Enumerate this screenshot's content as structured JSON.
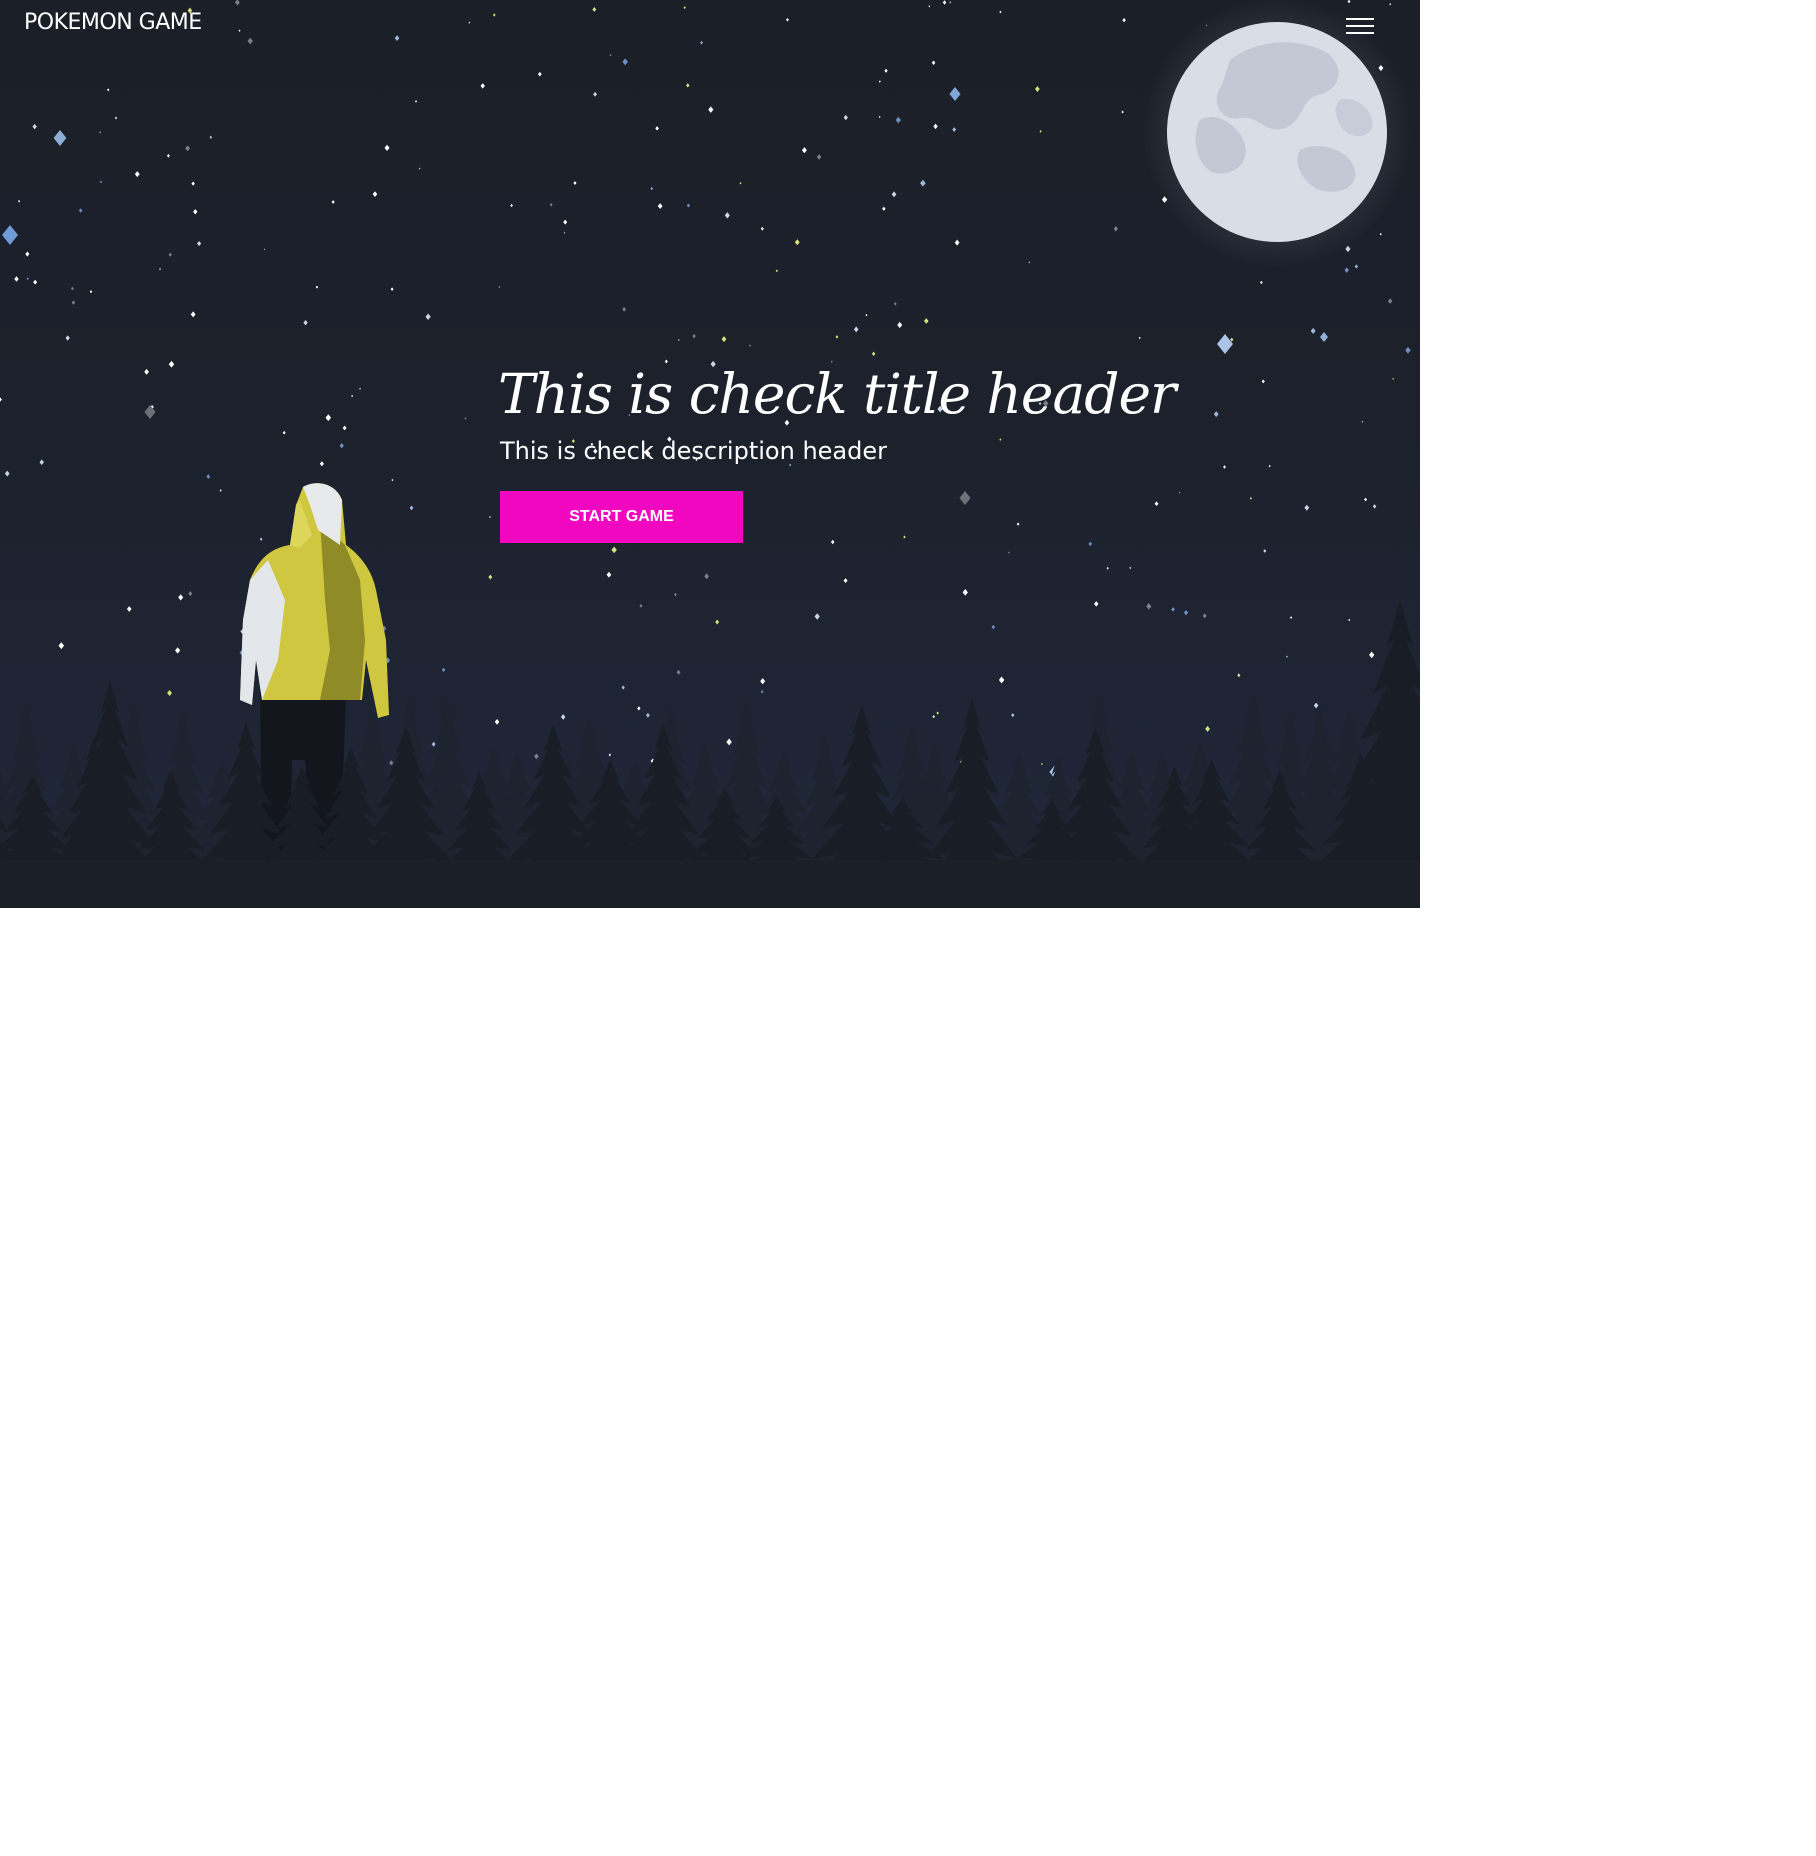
{
  "header": {
    "brand": "POKEMON GAME",
    "menu_icon": "hamburger-menu-icon"
  },
  "hero": {
    "title": "This is check title header",
    "description": "This is check description header",
    "start_button_label": "START GAME"
  },
  "colors": {
    "background": "#1c202a",
    "button": "#f007bf",
    "text": "#ffffff",
    "moon": "#d9dde5",
    "jacket": "#cfc83e"
  },
  "decor": {
    "moon_icon": "moon-icon",
    "person_icon": "hooded-person-illustration",
    "trees_icon": "pine-forest-silhouette"
  }
}
